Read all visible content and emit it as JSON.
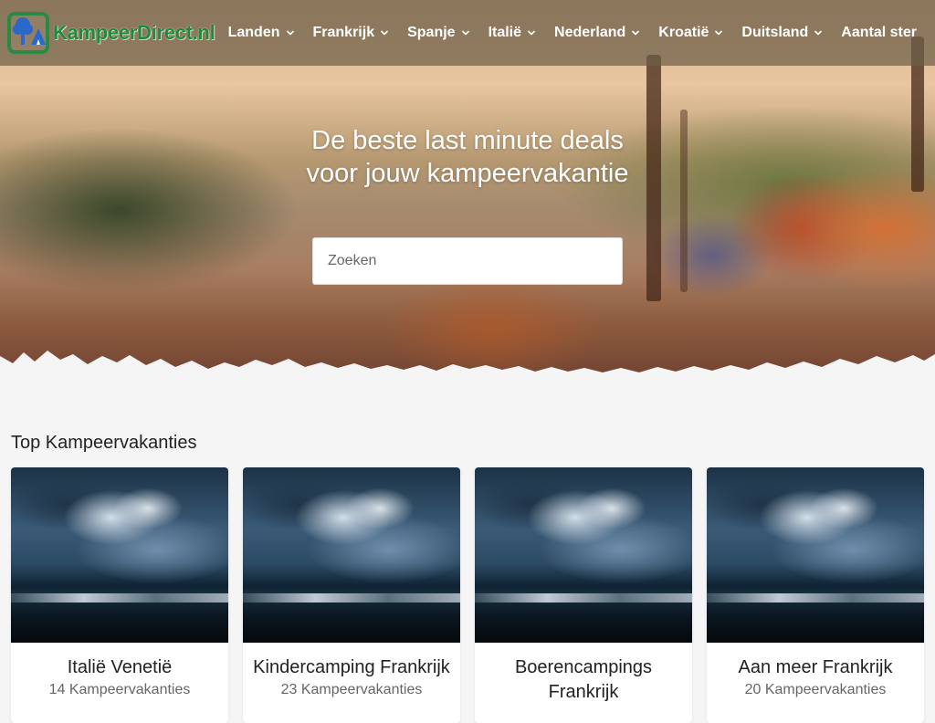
{
  "brand": {
    "name": "KampeerDirect.nl",
    "color": "#2a8a43"
  },
  "nav": {
    "items": [
      {
        "label": "Landen"
      },
      {
        "label": "Frankrijk"
      },
      {
        "label": "Spanje"
      },
      {
        "label": "Italië"
      },
      {
        "label": "Nederland"
      },
      {
        "label": "Kroatië"
      },
      {
        "label": "Duitsland"
      },
      {
        "label": "Aantal ster"
      }
    ]
  },
  "hero": {
    "headline": "De beste last minute deals voor jouw kampeervakantie",
    "search_placeholder": "Zoeken"
  },
  "section": {
    "title": "Top Kampeervakanties",
    "cards": [
      {
        "title": "Italië Venetië",
        "count": "14 Kampeervakanties"
      },
      {
        "title": "Kindercamping Frankrijk",
        "count": "23 Kampeervakanties"
      },
      {
        "title": "Boerencampings Frankrijk",
        "count": ""
      },
      {
        "title": "Aan meer Frankrijk",
        "count": "20 Kampeervakanties"
      }
    ]
  }
}
